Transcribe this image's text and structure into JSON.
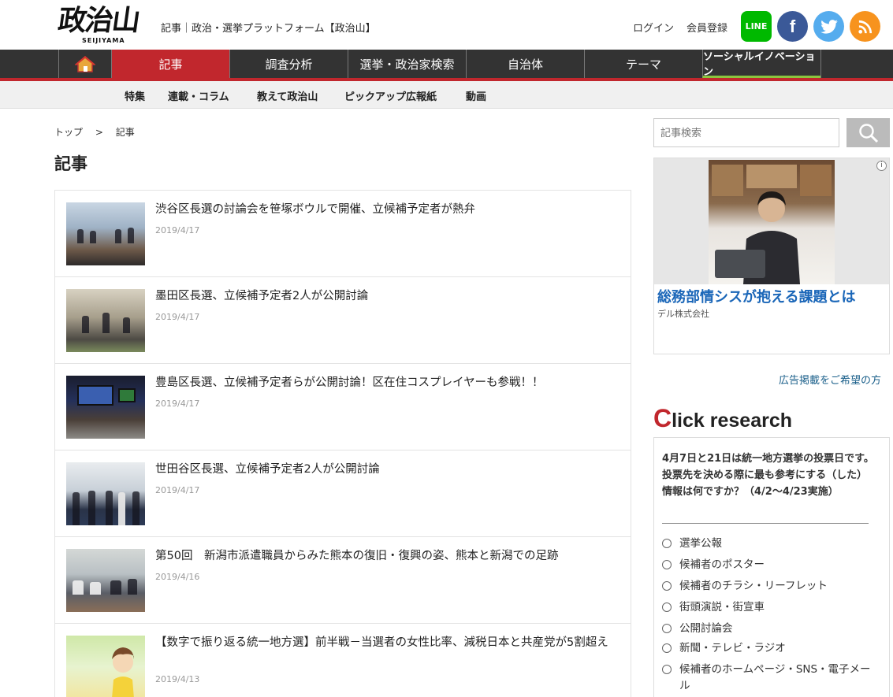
{
  "header": {
    "logo_text": "政治山",
    "logo_sub": "SEIJIYAMA",
    "tagline": "記事｜政治・選挙プラットフォーム【政治山】",
    "login": "ログイン",
    "signup": "会員登録",
    "sns": {
      "line": "LINE",
      "facebook": "f",
      "twitter": "🐦",
      "rss": "◉"
    }
  },
  "mainnav": {
    "items": [
      "記事",
      "調査分析",
      "選挙・政治家検索",
      "自治体",
      "テーマ",
      "ソーシャルイノベーション"
    ],
    "active": "記事",
    "colors": {
      "bar": "#333333",
      "active": "#c1272d",
      "accent": "#8bc53f"
    }
  },
  "subnav": {
    "items": [
      "特集",
      "連載・コラム",
      "教えて政治山",
      "ピックアップ広報紙",
      "動画"
    ]
  },
  "breadcrumb": {
    "home": "トップ",
    "sep": ">",
    "current": "記事"
  },
  "page_title": "記事",
  "articles": [
    {
      "title": "渋谷区長選の討論会を笹塚ボウルで開催、立候補予定者が熱弁",
      "date": "2019/4/17"
    },
    {
      "title": "墨田区長選、立候補予定者2人が公開討論",
      "date": "2019/4/17"
    },
    {
      "title": "豊島区長選、立候補予定者らが公開討論！区在住コスプレイヤーも参戦！！",
      "date": "2019/4/17"
    },
    {
      "title": "世田谷区長選、立候補予定者2人が公開討論",
      "date": "2019/4/17"
    },
    {
      "title": "第50回　新潟市派遣職員からみた熊本の復旧・復興の姿、熊本と新潟での足跡",
      "date": "2019/4/16"
    },
    {
      "title": "【数字で振り返る統一地方選】前半戦－当選者の女性比率、減税日本と共産党が5割超え",
      "date": "2019/4/13"
    }
  ],
  "sidebar": {
    "search_placeholder": "記事検索",
    "ad": {
      "headline": "総務部情シスが抱える課題とは",
      "company": "デル株式会社",
      "info": "i"
    },
    "ad_inquiry": "広告掲載をご希望の方",
    "click_research": {
      "first": "C",
      "rest": "lick research"
    },
    "poll": {
      "question": "4月7日と21日は統一地方選挙の投票日です。投票先を決める際に最も参考にする（した）情報は何ですか？（4/2〜4/23実施）",
      "options": [
        "選挙公報",
        "候補者のポスター",
        "候補者のチラシ・リーフレット",
        "街頭演説・街宣車",
        "公開討論会",
        "新聞・テレビ・ラジオ",
        "候補者のホームページ・SNS・電子メール"
      ]
    }
  }
}
